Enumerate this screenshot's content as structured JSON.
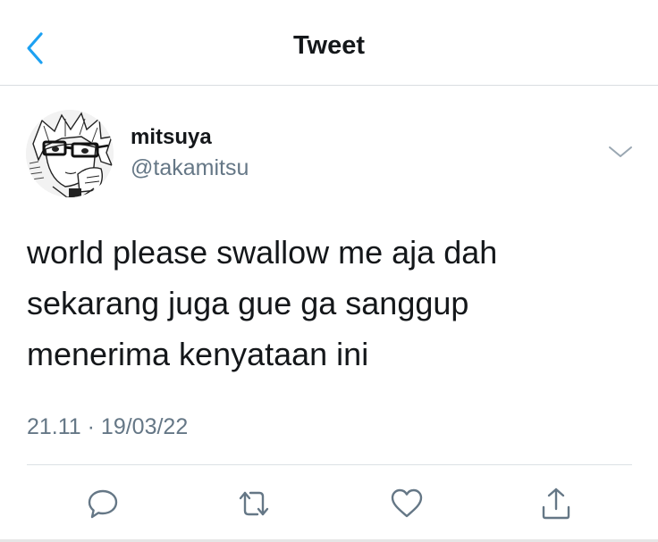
{
  "colors": {
    "accent": "#1da1f2",
    "text": "#14171a",
    "secondary": "#657786",
    "divider": "#d9dde1"
  },
  "navbar": {
    "title": "Tweet",
    "back_icon": "chevron-left-icon"
  },
  "tweet": {
    "author": {
      "display_name": "mitsuya",
      "handle": "@takamitsu",
      "avatar_icon": "manga-avatar"
    },
    "more_icon": "chevron-down-icon",
    "text_lines": [
      "world please swallow me aja dah",
      "sekarang juga gue ga sanggup",
      "menerima kenyataan ini"
    ],
    "timestamp": "21.11 · 19/03/22"
  },
  "actions": [
    {
      "icon": "reply-icon"
    },
    {
      "icon": "retweet-icon"
    },
    {
      "icon": "like-icon"
    },
    {
      "icon": "share-icon"
    }
  ]
}
